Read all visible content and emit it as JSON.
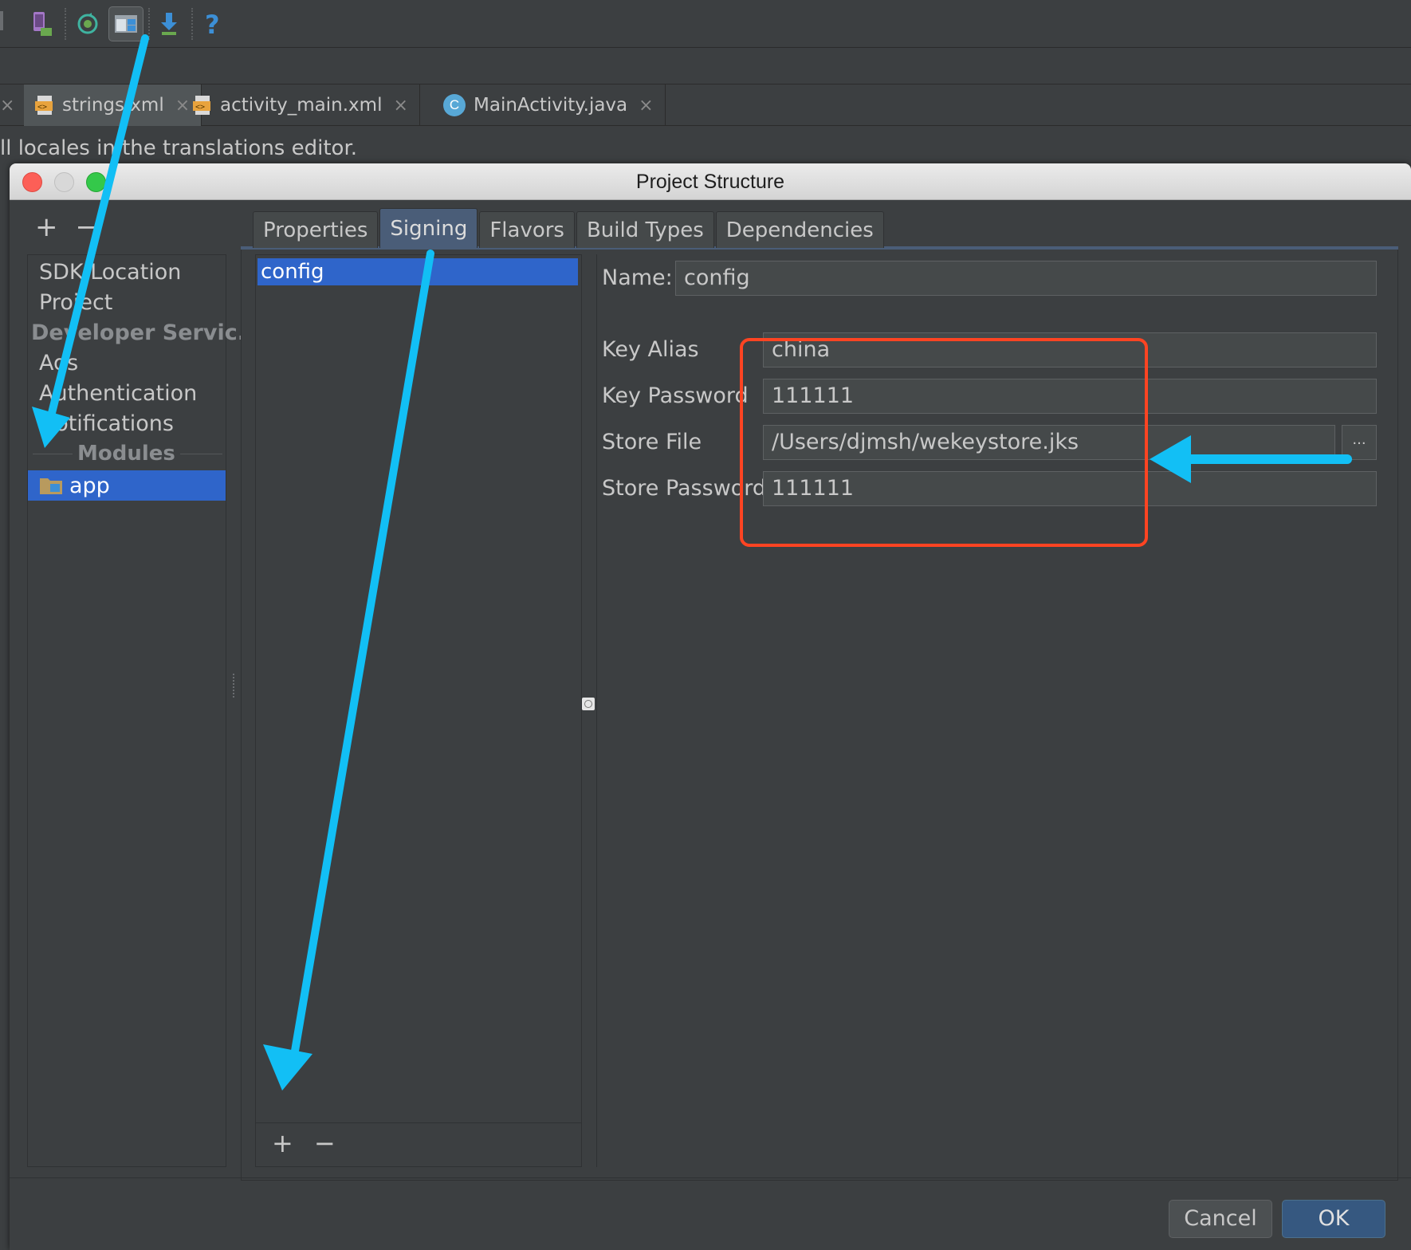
{
  "editor_tabs": [
    {
      "label": "strings.xml",
      "icon": "xml-file-icon",
      "selected": true
    },
    {
      "label": "activity_main.xml",
      "icon": "xml-file-icon",
      "selected": false
    },
    {
      "label": "MainActivity.java",
      "icon": "java-class-icon",
      "icon_letter": "C",
      "selected": false
    }
  ],
  "banner_text": "ll locales in the translations editor.",
  "dialog": {
    "title": "Project Structure",
    "left_tools": {
      "add": "+",
      "remove": "−"
    },
    "left_items": [
      {
        "label": "SDK Location"
      },
      {
        "label": "Project"
      },
      {
        "label": "Developer Servic..."
      },
      {
        "label": "Ads"
      },
      {
        "label": "Authentication"
      },
      {
        "label": "Notifications"
      }
    ],
    "modules_header": "Modules",
    "module_selected": "app",
    "tabs": [
      "Properties",
      "Signing",
      "Flavors",
      "Build Types",
      "Dependencies"
    ],
    "selected_tab": "Signing",
    "config_list": [
      "config"
    ],
    "config_tools": {
      "add": "+",
      "remove": "−"
    },
    "form": {
      "name_label": "Name:",
      "name_value": "config",
      "key_alias_label": "Key Alias",
      "key_alias_value": "china",
      "key_password_label": "Key Password",
      "key_password_value": "111111",
      "store_file_label": "Store File",
      "store_file_value": "/Users/djmsh/wekeystore.jks",
      "browse_label": "...",
      "store_password_label": "Store Password",
      "store_password_value": "111111"
    },
    "buttons": {
      "cancel": "Cancel",
      "ok": "OK"
    }
  },
  "colors": {
    "accent_selection": "#2f65ca",
    "annotation_arrow": "#12bff5",
    "annotation_box": "#ff4422"
  }
}
